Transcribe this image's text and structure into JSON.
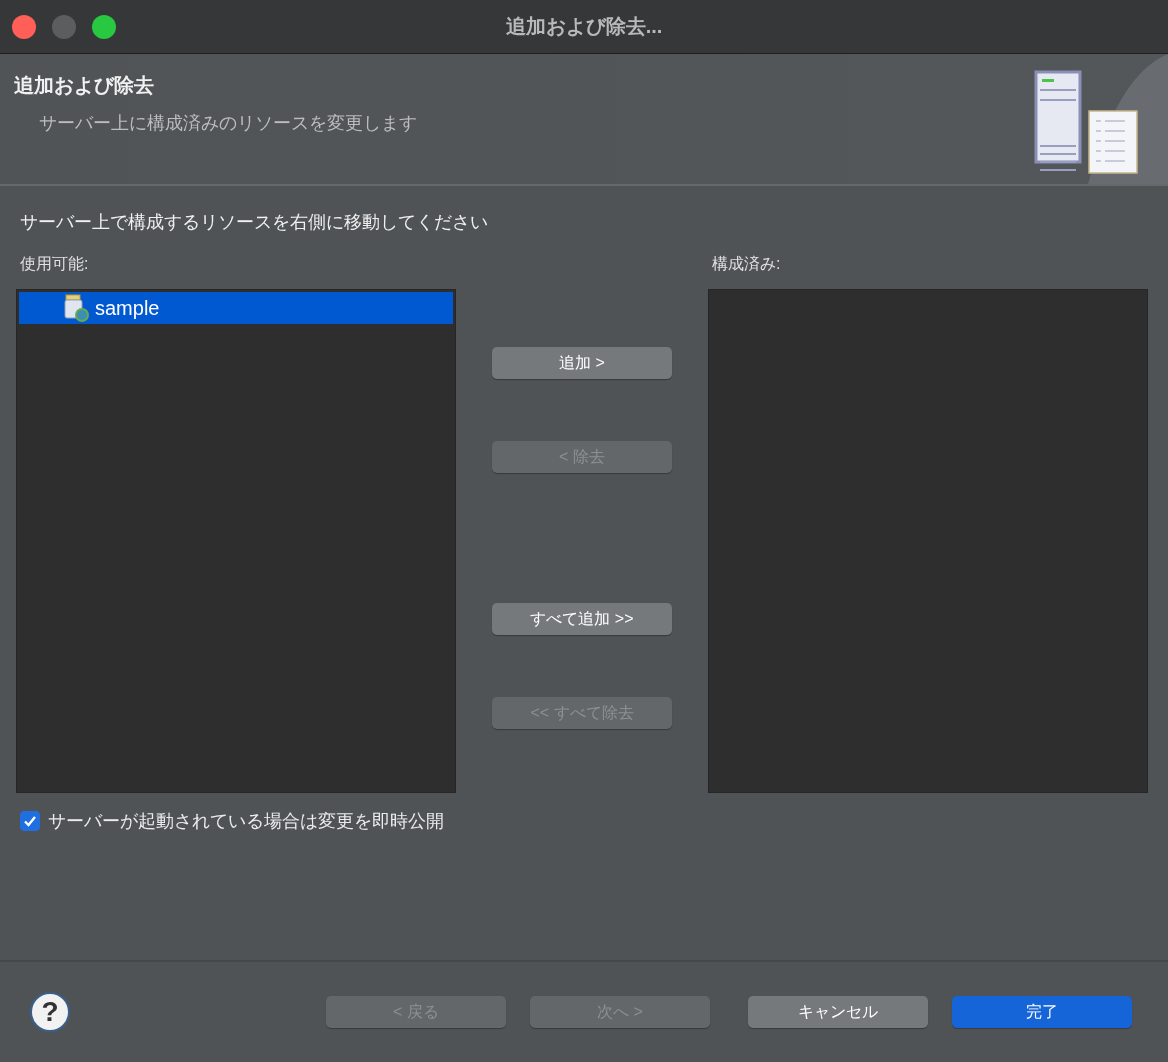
{
  "window": {
    "title": "追加および除去..."
  },
  "header": {
    "title": "追加および除去",
    "description": "サーバー上に構成済みのリソースを変更します"
  },
  "instruction": "サーバー上で構成するリソースを右側に移動してください",
  "available": {
    "label": "使用可能:",
    "items": [
      {
        "label": "sample",
        "selected": true
      }
    ]
  },
  "configured": {
    "label": "構成済み:"
  },
  "move_buttons": [
    {
      "label": "追加 >",
      "disabled": false
    },
    {
      "label": "< 除去",
      "disabled": true
    },
    {
      "label": "すべて追加 >>",
      "disabled": false
    },
    {
      "label": "<< すべて除去",
      "disabled": true
    }
  ],
  "publish_option": {
    "label": "サーバーが起動されている場合は変更を即時公開",
    "checked": true
  },
  "help_button": {
    "glyph": "?"
  },
  "footer_buttons": [
    {
      "label": "< 戻る",
      "kind": "normal",
      "disabled": true
    },
    {
      "label": "次へ >",
      "kind": "normal",
      "disabled": true
    },
    {
      "label": "キャンセル",
      "kind": "normal",
      "disabled": false
    },
    {
      "label": "完了",
      "kind": "default",
      "disabled": false
    }
  ]
}
